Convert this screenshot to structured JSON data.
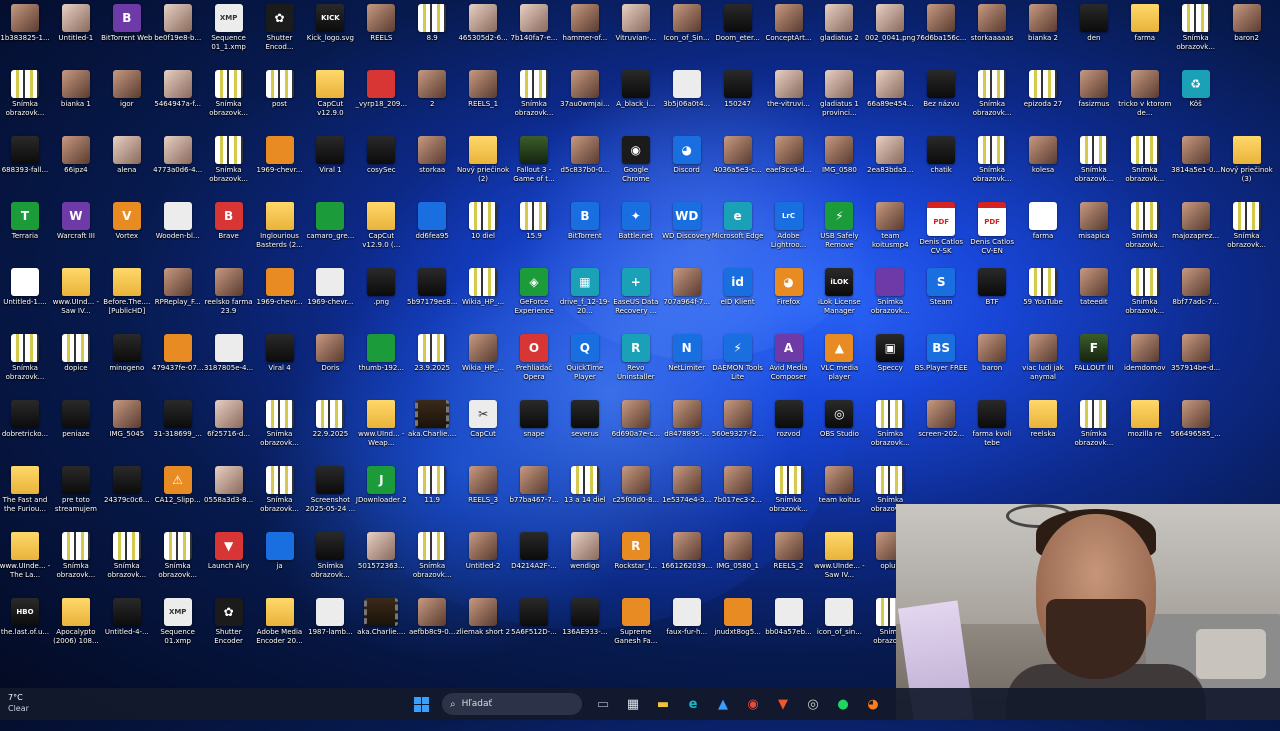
{
  "desktop": {
    "icons": [
      {
        "label": "1b383825-1...",
        "kind": "photo"
      },
      {
        "label": "Untitled-1",
        "kind": "photo2"
      },
      {
        "label": "BitTorrent Web",
        "kind": "purple",
        "glyph": "B"
      },
      {
        "label": "be0f19e8-b...",
        "kind": "photo2"
      },
      {
        "label": "Sequence 01_1.xmp",
        "kind": "white",
        "glyph": "XMP"
      },
      {
        "label": "Shutter Encod...",
        "kind": "app",
        "glyph": "✿"
      },
      {
        "label": "Kick_logo.svg",
        "kind": "dark",
        "glyph": "KICK"
      },
      {
        "label": "REELS",
        "kind": "photo"
      },
      {
        "label": "8.9",
        "kind": "shot"
      },
      {
        "label": "465305d2-6...",
        "kind": "photo2"
      },
      {
        "label": "7b140fa7-e...",
        "kind": "photo2"
      },
      {
        "label": "hammer-of...",
        "kind": "photo"
      },
      {
        "label": "Vitruvian-...",
        "kind": "photo2"
      },
      {
        "label": "Icon_of_Sin...",
        "kind": "photo"
      },
      {
        "label": "Doom_eter...",
        "kind": "dark"
      },
      {
        "label": "ConceptArt...",
        "kind": "photo"
      },
      {
        "label": "gladiatus 2",
        "kind": "photo2"
      },
      {
        "label": "002_0041.png",
        "kind": "photo2"
      },
      {
        "label": "76d6ba156c...",
        "kind": "photo"
      },
      {
        "label": "storkaaaaas",
        "kind": "photo"
      },
      {
        "label": "bianka 2",
        "kind": "photo"
      },
      {
        "label": "den",
        "kind": "dark"
      },
      {
        "label": "farma",
        "kind": "folder"
      },
      {
        "label": "Snímka obrazovk...",
        "kind": "shot"
      },
      {
        "label": "baron2",
        "kind": "photo"
      },
      {
        "label": "Snímka obrazovk...",
        "kind": "shot"
      },
      {
        "label": "bianka 1",
        "kind": "photo"
      },
      {
        "label": "igor",
        "kind": "photo"
      },
      {
        "label": "5464947a-f...",
        "kind": "photo2"
      },
      {
        "label": "Snímka obrazovk...",
        "kind": "shot"
      },
      {
        "label": "post",
        "kind": "shot"
      },
      {
        "label": "CapCut v12.9.0",
        "kind": "folder"
      },
      {
        "label": "_vyrp18_209...",
        "kind": "red"
      },
      {
        "label": "2",
        "kind": "photo"
      },
      {
        "label": "REELS_1",
        "kind": "photo"
      },
      {
        "label": "Snímka obrazovk...",
        "kind": "shot"
      },
      {
        "label": "37au0wmjai...",
        "kind": "photo"
      },
      {
        "label": "A_black_i...",
        "kind": "dark"
      },
      {
        "label": "3b5j06a0t4...",
        "kind": "white"
      },
      {
        "label": "150247",
        "kind": "dark"
      },
      {
        "label": "the-vitruvi...",
        "kind": "photo2"
      },
      {
        "label": "gladiatus 1 provinci...",
        "kind": "photo2"
      },
      {
        "label": "66a89e454...",
        "kind": "photo2"
      },
      {
        "label": "Bez názvu",
        "kind": "dark"
      },
      {
        "label": "Snímka obrazovk...",
        "kind": "shot"
      },
      {
        "label": "epizoda 27",
        "kind": "shot"
      },
      {
        "label": "fasizmus",
        "kind": "photo"
      },
      {
        "label": "tricko v ktorom de...",
        "kind": "photo"
      },
      {
        "label": "Kôš",
        "kind": "teal",
        "glyph": "♻"
      },
      {
        "label": "688393-fall...",
        "kind": "dark"
      },
      {
        "label": "66ipz4",
        "kind": "photo"
      },
      {
        "label": "alena",
        "kind": "photo2"
      },
      {
        "label": "4773a0d6-4...",
        "kind": "photo2"
      },
      {
        "label": "Snímka obrazovk...",
        "kind": "shot"
      },
      {
        "label": "1969-chevr...",
        "kind": "orange"
      },
      {
        "label": "Viral 1",
        "kind": "dark"
      },
      {
        "label": "cosySec",
        "kind": "dark"
      },
      {
        "label": "storkaa",
        "kind": "photo"
      },
      {
        "label": "Nový priečinok (2)",
        "kind": "folder"
      },
      {
        "label": "Fallout 3 - Game of t...",
        "kind": "game"
      },
      {
        "label": "d5c837b0-0...",
        "kind": "photo"
      },
      {
        "label": "Google Chrome",
        "kind": "app",
        "glyph": "◉"
      },
      {
        "label": "Discord",
        "kind": "blue",
        "glyph": "◕"
      },
      {
        "label": "4036a5e3-c...",
        "kind": "photo"
      },
      {
        "label": "eaef3cc4-d...",
        "kind": "photo"
      },
      {
        "label": "IMG_0580",
        "kind": "photo"
      },
      {
        "label": "2ea83bda3...",
        "kind": "photo2"
      },
      {
        "label": "chatik",
        "kind": "dark"
      },
      {
        "label": "Snímka obrazovk...",
        "kind": "shot"
      },
      {
        "label": "kolesa",
        "kind": "photo"
      },
      {
        "label": "Snímka obrazovk...",
        "kind": "shot"
      },
      {
        "label": "Snímka obrazovk...",
        "kind": "shot"
      },
      {
        "label": "3814a5e1-0...",
        "kind": "photo"
      },
      {
        "label": "Nový priečinok (3)",
        "kind": "folder"
      },
      {
        "label": "Terraria",
        "kind": "green",
        "glyph": "T"
      },
      {
        "label": "Warcraft III",
        "kind": "purple",
        "glyph": "W"
      },
      {
        "label": "Vortex",
        "kind": "orange",
        "glyph": "V"
      },
      {
        "label": "Wooden-bl...",
        "kind": "white"
      },
      {
        "label": "Brave",
        "kind": "red",
        "glyph": "B"
      },
      {
        "label": "Inglourious Basterds (2...",
        "kind": "folder"
      },
      {
        "label": "camaro_gre...",
        "kind": "green"
      },
      {
        "label": "CapCut v12.9.0 (...",
        "kind": "folder"
      },
      {
        "label": "dd6fea95",
        "kind": "blue"
      },
      {
        "label": "10 diel",
        "kind": "shot"
      },
      {
        "label": "15.9",
        "kind": "shot"
      },
      {
        "label": "BitTorrent",
        "kind": "blue",
        "glyph": "B"
      },
      {
        "label": "Battle.net",
        "kind": "blue",
        "glyph": "✦"
      },
      {
        "label": "WD Discovery",
        "kind": "blue",
        "glyph": "WD"
      },
      {
        "label": "Microsoft Edge",
        "kind": "teal",
        "glyph": "e"
      },
      {
        "label": "Adobe Lightroo...",
        "kind": "blue",
        "glyph": "LrC"
      },
      {
        "label": "USB Safely Remove",
        "kind": "green",
        "glyph": "⚡"
      },
      {
        "label": "team koitusmp4",
        "kind": "photo"
      },
      {
        "label": "Denis Catlos CV-SK",
        "kind": "pdf",
        "glyph": "PDF"
      },
      {
        "label": "Denis Catlos CV-EN",
        "kind": "pdf",
        "glyph": "PDF"
      },
      {
        "label": "farma",
        "kind": "doc"
      },
      {
        "label": "misapica",
        "kind": "photo"
      },
      {
        "label": "Snímka obrazovk...",
        "kind": "shot"
      },
      {
        "label": "majozaprez...",
        "kind": "photo"
      },
      {
        "label": "Snímka obrazovk...",
        "kind": "shot"
      },
      {
        "label": "Untitled-1....",
        "kind": "doc"
      },
      {
        "label": "www.UInd... - Saw IV...",
        "kind": "folder"
      },
      {
        "label": "Before.The.... [PublicHD]",
        "kind": "folder"
      },
      {
        "label": "RPReplay_F...",
        "kind": "photo"
      },
      {
        "label": "reelsko farma 23.9",
        "kind": "photo"
      },
      {
        "label": "1969-chevr...",
        "kind": "orange"
      },
      {
        "label": "1969-chevr...",
        "kind": "white"
      },
      {
        "label": ".png",
        "kind": "dark"
      },
      {
        "label": "5b97179ec8...",
        "kind": "dark"
      },
      {
        "label": "Wikia_HP_...",
        "kind": "shot"
      },
      {
        "label": "GeForce Experience",
        "kind": "green",
        "glyph": "◈"
      },
      {
        "label": "drive_f_12-19-20...",
        "kind": "teal",
        "glyph": "▦"
      },
      {
        "label": "EaseUS Data Recovery ...",
        "kind": "teal",
        "glyph": "+"
      },
      {
        "label": "707a964f-7...",
        "kind": "photo"
      },
      {
        "label": "eID Klient",
        "kind": "blue",
        "glyph": "id"
      },
      {
        "label": "Firefox",
        "kind": "orange",
        "glyph": "◕"
      },
      {
        "label": "iLok License Manager",
        "kind": "dark",
        "glyph": "iLOK"
      },
      {
        "label": "Snímka obrazovk...",
        "kind": "purple"
      },
      {
        "label": "Steam",
        "kind": "blue",
        "glyph": "S"
      },
      {
        "label": "BTF",
        "kind": "dark"
      },
      {
        "label": "59 YouTube",
        "kind": "shot"
      },
      {
        "label": "tateedit",
        "kind": "photo"
      },
      {
        "label": "Snímka obrazovk...",
        "kind": "shot"
      },
      {
        "label": "8bf77adc-7...",
        "kind": "photo"
      },
      {
        "label": "Snímka obrazovk...",
        "kind": "shot"
      },
      {
        "label": "dopice",
        "kind": "shot"
      },
      {
        "label": "minogeno",
        "kind": "dark"
      },
      {
        "label": "479437fe-07...",
        "kind": "orange"
      },
      {
        "label": "3187805e-4...",
        "kind": "white"
      },
      {
        "label": "Viral 4",
        "kind": "dark"
      },
      {
        "label": "Doris",
        "kind": "photo"
      },
      {
        "label": "thumb-192...",
        "kind": "green"
      },
      {
        "label": "23.9.2025",
        "kind": "shot"
      },
      {
        "label": "Wikia_HP_...",
        "kind": "photo"
      },
      {
        "label": "Prehliadač Opera",
        "kind": "red",
        "glyph": "O"
      },
      {
        "label": "QuickTime Player",
        "kind": "blue",
        "glyph": "Q"
      },
      {
        "label": "Revo Uninstaller",
        "kind": "teal",
        "glyph": "R"
      },
      {
        "label": "NetLimiter",
        "kind": "blue",
        "glyph": "N"
      },
      {
        "label": "DAEMON Tools Lite",
        "kind": "blue",
        "glyph": "⚡"
      },
      {
        "label": "Avid Media Composer",
        "kind": "purple",
        "glyph": "A"
      },
      {
        "label": "VLC media player",
        "kind": "orange",
        "glyph": "▲"
      },
      {
        "label": "Speccy",
        "kind": "dark",
        "glyph": "▣"
      },
      {
        "label": "BS.Player FREE",
        "kind": "blue",
        "glyph": "BS"
      },
      {
        "label": "baron",
        "kind": "photo"
      },
      {
        "label": "viac ludi jak anymal",
        "kind": "photo"
      },
      {
        "label": "FALLOUT III",
        "kind": "game",
        "glyph": "F"
      },
      {
        "label": "idemdomov",
        "kind": "photo"
      },
      {
        "label": "357914be-d...",
        "kind": "photo"
      },
      {
        "label": "dobretricko...",
        "kind": "dark"
      },
      {
        "label": "peniaze",
        "kind": "dark"
      },
      {
        "label": "IMG_5045",
        "kind": "photo"
      },
      {
        "label": "31-318699_...",
        "kind": "dark"
      },
      {
        "label": "6f25716-d...",
        "kind": "photo2"
      },
      {
        "label": "Snímka obrazovk...",
        "kind": "shot"
      },
      {
        "label": "22.9.2025",
        "kind": "shot"
      },
      {
        "label": "www.UInd... - Weap...",
        "kind": "folder"
      },
      {
        "label": "aka.Charlie....",
        "kind": "video"
      },
      {
        "label": "CapCut",
        "kind": "white",
        "glyph": "✂"
      },
      {
        "label": "snape",
        "kind": "dark"
      },
      {
        "label": "severus",
        "kind": "dark"
      },
      {
        "label": "6d690a7e-c...",
        "kind": "photo"
      },
      {
        "label": "d8478895-...",
        "kind": "photo"
      },
      {
        "label": "560e9327-f2...",
        "kind": "photo"
      },
      {
        "label": "rozvod",
        "kind": "dark"
      },
      {
        "label": "OBS Studio",
        "kind": "dark",
        "glyph": "◎"
      },
      {
        "label": "Snímka obrazovk...",
        "kind": "shot"
      },
      {
        "label": "screen-202...",
        "kind": "photo"
      },
      {
        "label": "farma kvoli tebe",
        "kind": "dark"
      },
      {
        "label": "reelska",
        "kind": "folder"
      },
      {
        "label": "Snímka obrazovk...",
        "kind": "shot"
      },
      {
        "label": "mozilla re",
        "kind": "folder"
      },
      {
        "label": "566496585_...",
        "kind": "photo"
      },
      {
        "label": "The Fast and the Furiou...",
        "kind": "folder"
      },
      {
        "label": "pre toto streamujem",
        "kind": "dark"
      },
      {
        "label": "24379c0c6...",
        "kind": "dark"
      },
      {
        "label": "CA12_Slipp...",
        "kind": "orange",
        "glyph": "⚠"
      },
      {
        "label": "0558a3d3-8...",
        "kind": "photo2"
      },
      {
        "label": "Snímka obrazovk...",
        "kind": "shot"
      },
      {
        "label": "Screenshot 2025-05-24 ...",
        "kind": "dark"
      },
      {
        "label": "JDownloader 2",
        "kind": "green",
        "glyph": "J"
      },
      {
        "label": "11.9",
        "kind": "shot"
      },
      {
        "label": "REELS_3",
        "kind": "photo"
      },
      {
        "label": "b77ba467-7...",
        "kind": "photo"
      },
      {
        "label": "13 a 14 diel",
        "kind": "shot"
      },
      {
        "label": "c25f00d0-8...",
        "kind": "photo"
      },
      {
        "label": "1e5374e4-3...",
        "kind": "photo"
      },
      {
        "label": "7b017ec3-2...",
        "kind": "photo"
      },
      {
        "label": "Snímka obrazovk...",
        "kind": "shot"
      },
      {
        "label": "team koitus",
        "kind": "photo"
      },
      {
        "label": "Snímka obrazovk...",
        "kind": "shot"
      },
      {
        "label": "www.UInde... - The La...",
        "kind": "folder"
      },
      {
        "label": "Snímka obrazovk...",
        "kind": "shot"
      },
      {
        "label": "Snímka obrazovk...",
        "kind": "shot"
      },
      {
        "label": "Snímka obrazovk...",
        "kind": "shot"
      },
      {
        "label": "Launch Airy",
        "kind": "red",
        "glyph": "▼"
      },
      {
        "label": "ja",
        "kind": "blue"
      },
      {
        "label": "Snímka obrazovk...",
        "kind": "dark"
      },
      {
        "label": "501572363...",
        "kind": "photo2"
      },
      {
        "label": "Snímka obrazovk...",
        "kind": "shot"
      },
      {
        "label": "Untitled-2",
        "kind": "photo"
      },
      {
        "label": "D4214A2F-...",
        "kind": "dark"
      },
      {
        "label": "wendigo",
        "kind": "photo2"
      },
      {
        "label": "Rockstar_I...",
        "kind": "orange",
        "glyph": "R"
      },
      {
        "label": "1661262039...",
        "kind": "photo"
      },
      {
        "label": "IMG_0580_1",
        "kind": "photo"
      },
      {
        "label": "REELS_2",
        "kind": "photo"
      },
      {
        "label": "www.UInde... - Saw IV...",
        "kind": "folder"
      },
      {
        "label": "oplutí",
        "kind": "photo"
      },
      {
        "label": "the.last.of.u...",
        "kind": "dark",
        "glyph": "HBO"
      },
      {
        "label": "Apocalypto (2006) 108...",
        "kind": "folder"
      },
      {
        "label": "Untitled-4-...",
        "kind": "dark"
      },
      {
        "label": "Sequence 01.xmp",
        "kind": "white",
        "glyph": "XMP"
      },
      {
        "label": "Shutter Encoder",
        "kind": "app",
        "glyph": "✿"
      },
      {
        "label": "Adobe Media Encoder 20...",
        "kind": "folder"
      },
      {
        "label": "1987-lamb...",
        "kind": "white"
      },
      {
        "label": "aka.Charlie....",
        "kind": "video"
      },
      {
        "label": "aefbb8c9-0...",
        "kind": "photo"
      },
      {
        "label": "zliemak short 2",
        "kind": "photo"
      },
      {
        "label": "5A6F512D-...",
        "kind": "dark"
      },
      {
        "label": "136AE933-...",
        "kind": "dark"
      },
      {
        "label": "Supreme Ganesh Fa...",
        "kind": "orange"
      },
      {
        "label": "faux-fur-h...",
        "kind": "white"
      },
      {
        "label": "jnudxt8og5...",
        "kind": "orange"
      },
      {
        "label": "bb04a57eb...",
        "kind": "white"
      },
      {
        "label": "icon_of_sin...",
        "kind": "white"
      },
      {
        "label": "Snímk obrazov...",
        "kind": "shot"
      }
    ],
    "rows": [
      25,
      24,
      25,
      25,
      24,
      24,
      24,
      18,
      18,
      18
    ]
  },
  "taskbar": {
    "weather": {
      "temp": "7°C",
      "condition": "Clear"
    },
    "search_placeholder": "Hľadať",
    "pinned": [
      {
        "name": "task-view",
        "glyph": "▭",
        "color": "#9aa4b8"
      },
      {
        "name": "store",
        "glyph": "▦",
        "color": "#e1e5ee"
      },
      {
        "name": "file-explorer",
        "glyph": "▬",
        "color": "#f2c23a"
      },
      {
        "name": "edge",
        "glyph": "e",
        "color": "#1fb6c9"
      },
      {
        "name": "photos",
        "glyph": "▲",
        "color": "#3a9dff"
      },
      {
        "name": "chrome",
        "glyph": "◉",
        "color": "#e34b3b"
      },
      {
        "name": "brave",
        "glyph": "▼",
        "color": "#f0552b"
      },
      {
        "name": "obs",
        "glyph": "◎",
        "color": "#d0d0d0"
      },
      {
        "name": "spotify",
        "glyph": "●",
        "color": "#1ed760"
      },
      {
        "name": "firefox",
        "glyph": "◕",
        "color": "#ff7b1c"
      }
    ]
  }
}
